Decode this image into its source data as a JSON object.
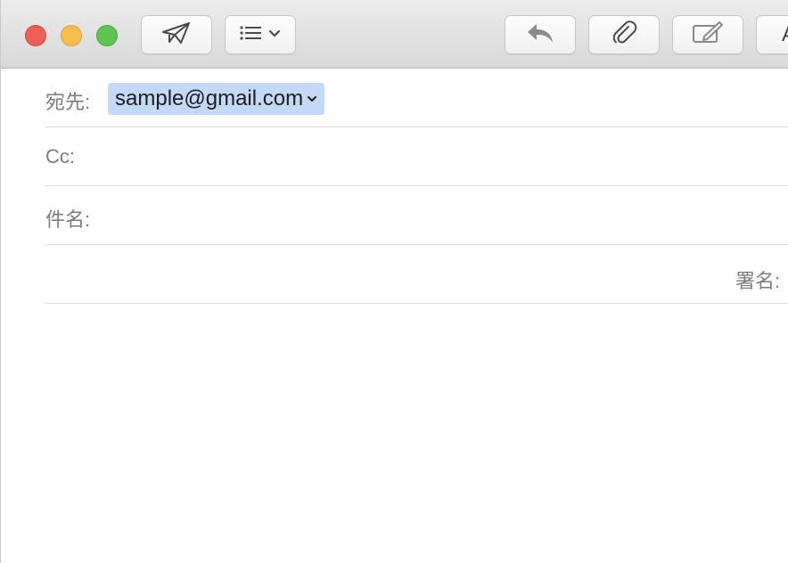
{
  "window": {
    "title": ""
  },
  "toolbar": {
    "send_icon": "paper-plane-icon",
    "format_icon": "list-icon",
    "reply_icon": "reply-arrow-icon",
    "attach_icon": "paperclip-icon",
    "markup_icon": "photo-markup-icon",
    "font_label": "A"
  },
  "fields": {
    "to_label": "宛先:",
    "to_recipient": "sample@gmail.com",
    "cc_label": "Cc:",
    "subject_label": "件名:",
    "signature_label": "署名:"
  },
  "colors": {
    "close": "#ee5f57",
    "minimize": "#f6be4f",
    "zoom": "#60c453",
    "token_bg": "#c3d9f7"
  }
}
